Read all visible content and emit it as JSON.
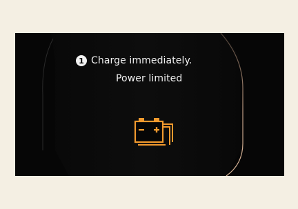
{
  "warning": {
    "number_badge": "1",
    "line1": "Charge immediately.",
    "line2": "Power limited",
    "icon": "low-battery-warning-icon"
  },
  "colors": {
    "background": "#f4efe3",
    "screen": "#060606",
    "text": "#f2f2f2",
    "icon": "#f29a2e",
    "frame": "#c9a48a"
  }
}
